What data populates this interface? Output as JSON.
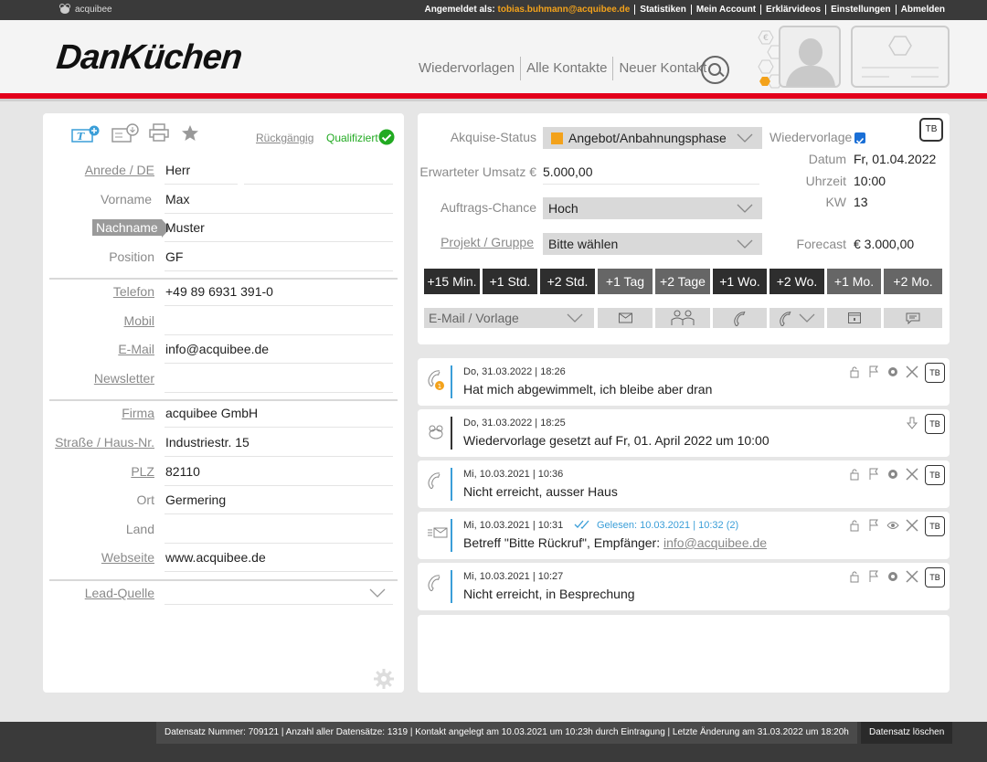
{
  "topbar": {
    "brand": "acquibee",
    "logged_in_label": "Angemeldet als:",
    "user_email": "tobias.buhmann@acquibee.de",
    "links": [
      "Statistiken",
      "Mein Account",
      "Erklärvideos",
      "Einstellungen",
      "Abmelden"
    ]
  },
  "header": {
    "logo": "DanKüchen",
    "nav": [
      "Wiedervorlagen",
      "Alle Kontakte",
      "Neuer Kontakt"
    ]
  },
  "contact": {
    "undo": "Rückgängig",
    "qualified": "Qualifiziert",
    "fields": {
      "anrede": {
        "label": "Anrede / DE",
        "value": "Herr"
      },
      "vorname": {
        "label": "Vorname",
        "value": "Max"
      },
      "nachname": {
        "label": "Nachname",
        "value": "Muster"
      },
      "position": {
        "label": "Position",
        "value": "GF"
      },
      "telefon": {
        "label": "Telefon",
        "value": "+49 89 6931 391-0"
      },
      "mobil": {
        "label": "Mobil",
        "value": ""
      },
      "email": {
        "label": "E-Mail",
        "value": "info@acquibee.de"
      },
      "newsletter": {
        "label": "Newsletter",
        "value": ""
      },
      "firma": {
        "label": "Firma",
        "value": "acquibee GmbH"
      },
      "strasse": {
        "label": "Straße / Haus-Nr.",
        "value": "Industriestr. 15"
      },
      "plz": {
        "label": "PLZ",
        "value": "82110"
      },
      "ort": {
        "label": "Ort",
        "value": "Germering"
      },
      "land": {
        "label": "Land",
        "value": ""
      },
      "webseite": {
        "label": "Webseite",
        "value": "www.acquibee.de"
      },
      "leadquelle": {
        "label": "Lead-Quelle",
        "value": ""
      }
    }
  },
  "deal": {
    "akquise_label": "Akquise-Status",
    "akquise_value": "Angebot/Anbahnungsphase",
    "akquise_color": "#f3a21b",
    "umsatz_label": "Erwarteter Umsatz €",
    "umsatz_value": "5.000,00",
    "chance_label": "Auftrags-Chance",
    "chance_value": "Hoch",
    "projekt_label": "Projekt / Gruppe",
    "projekt_value": "Bitte wählen",
    "wiedervorlage_label": "Wiedervorlage",
    "wiedervorlage_checked": true,
    "datum_label": "Datum",
    "datum_value": "Fr, 01.04.2022",
    "uhrzeit_label": "Uhrzeit",
    "uhrzeit_value": "10:00",
    "kw_label": "KW",
    "kw_value": "13",
    "forecast_label": "Forecast",
    "forecast_value": "€ 3.000,00",
    "tb_label": "TB",
    "time_buttons": [
      "+15 Min.",
      "+1 Std.",
      "+2 Std.",
      "+1 Tag",
      "+2 Tage",
      "+1 Wo.",
      "+2 Wo.",
      "+1 Mo.",
      "+2 Mo."
    ],
    "email_template": "E-Mail / Vorlage"
  },
  "activities": [
    {
      "date": "Do, 31.03.2022 | 18:26",
      "text": "Hat mich abgewimmelt, ich bleibe aber dran",
      "icon": "phone-icon"
    },
    {
      "date": "Do, 31.03.2022 | 18:25",
      "text": "Wiedervorlage gesetzt auf Fr, 01. April 2022 um 10:00",
      "icon": "bee-icon"
    },
    {
      "date": "Mi, 10.03.2021 | 10:36",
      "text": "Nicht erreicht, ausser Haus",
      "icon": "phone-icon"
    },
    {
      "date": "Mi, 10.03.2021 | 10:31",
      "read": "Gelesen: 10.03.2021 | 10:32 (2)",
      "text": "Betreff \"Bitte Rückruf\", Empfänger:",
      "recipient": "info@acquibee.de",
      "icon": "mail-icon"
    },
    {
      "date": "Mi, 10.03.2021 | 10:27",
      "text": "Nicht erreicht, in Besprechung",
      "icon": "phone-icon"
    }
  ],
  "footer": {
    "info": "Datensatz Nummer: 709121 | Anzahl aller Datensätze: 1319 | Kontakt angelegt am 10.03.2021 um 10:23h durch Eintragung | Letzte Änderung am 31.03.2022 um 18:20h",
    "delete": "Datensatz löschen"
  },
  "colors": {
    "accent": "#e3001b",
    "highlight": "#f3a21b",
    "link": "#3a9ed8",
    "check": "#22aa22"
  }
}
